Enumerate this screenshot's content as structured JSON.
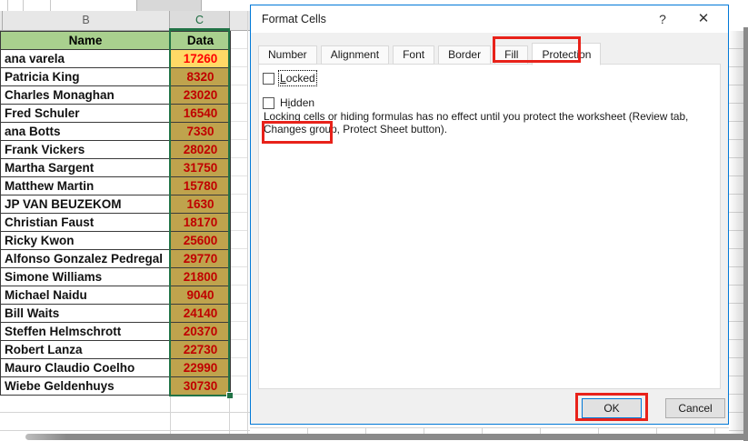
{
  "spreadsheet": {
    "column_headers": [
      "B",
      "C"
    ],
    "table": {
      "headers": [
        "Name",
        "Data"
      ],
      "rows": [
        {
          "name": "ana varela",
          "value": "17260"
        },
        {
          "name": "Patricia King",
          "value": "8320"
        },
        {
          "name": "Charles Monaghan",
          "value": "23020"
        },
        {
          "name": "Fred Schuler",
          "value": "16540"
        },
        {
          "name": "ana Botts",
          "value": "7330"
        },
        {
          "name": "Frank Vickers",
          "value": "28020"
        },
        {
          "name": "Martha Sargent",
          "value": "31750"
        },
        {
          "name": "Matthew Martin",
          "value": "15780"
        },
        {
          "name": "JP VAN BEUZEKOM",
          "value": "1630"
        },
        {
          "name": "Christian Faust",
          "value": "18170"
        },
        {
          "name": "Ricky Kwon",
          "value": "25600"
        },
        {
          "name": "Alfonso Gonzalez Pedregal",
          "value": "29770"
        },
        {
          "name": "Simone Williams",
          "value": "21800"
        },
        {
          "name": "Michael Naidu",
          "value": "9040"
        },
        {
          "name": "Bill Waits",
          "value": "24140"
        },
        {
          "name": "Steffen Helmschrott",
          "value": "20370"
        },
        {
          "name": "Robert Lanza",
          "value": "22730"
        },
        {
          "name": "Mauro Claudio Coelho",
          "value": "22990"
        },
        {
          "name": "Wiebe Geldenhuys",
          "value": "30730"
        }
      ]
    },
    "colors": {
      "header_fill": "#a9d08e",
      "active_cell_fill": "#ffd966",
      "selected_cell_fill": "#bfa34d",
      "value_text_active": "#ff0000",
      "value_text_selected": "#c00000",
      "selection_border": "#217346"
    }
  },
  "dialog": {
    "title": "Format Cells",
    "help_icon": "?",
    "close_icon": "✕",
    "tabs": [
      {
        "label": "Number",
        "active": false
      },
      {
        "label": "Alignment",
        "active": false
      },
      {
        "label": "Font",
        "active": false
      },
      {
        "label": "Border",
        "active": false
      },
      {
        "label": "Fill",
        "active": false
      },
      {
        "label": "Protection",
        "active": true
      }
    ],
    "checkboxes": {
      "locked": {
        "pre": "",
        "accel": "L",
        "rest": "ocked",
        "checked": false
      },
      "hidden": {
        "pre": "H",
        "accel": "i",
        "rest": "dden",
        "checked": false
      }
    },
    "description_line1": "Locking cells or hiding formulas has no effect until you protect the worksheet (Review tab,",
    "description_line2": "Changes group, Protect Sheet button).",
    "buttons": {
      "ok": "OK",
      "cancel": "Cancel"
    },
    "accent_color": "#0078d7",
    "callout_color": "#e8221a"
  }
}
